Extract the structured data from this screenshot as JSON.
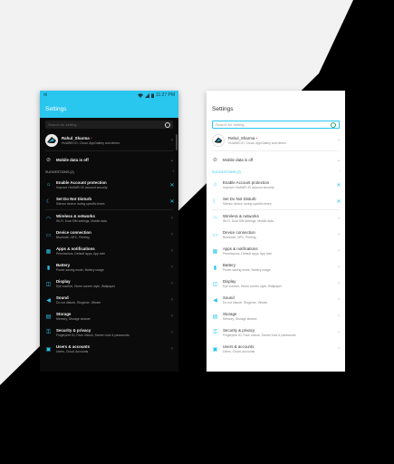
{
  "colors": {
    "accent": "#29c6ee",
    "dark_bg": "#0b0b0b",
    "light_bg": "#ffffff",
    "backdrop_dark": "#000000",
    "backdrop_light": "#f2f2f2"
  },
  "dark": {
    "status": {
      "left": "✉",
      "time": "11:27 PM"
    },
    "title": "Settings",
    "search_placeholder": "Search for setting...",
    "account": {
      "name": "Rahul_Sharma",
      "sub": "HUAWEI ID, Cloud, AppGallery and others"
    },
    "mobile_data": "Mobile data is off",
    "suggestions_label": "SUGGESTIONS (2)",
    "suggestions": [
      {
        "title": "Enable Account protection",
        "sub": "Improve HUAWEI ID account security",
        "icon": "home-icon"
      },
      {
        "title": "Set Do Not Disturb",
        "sub": "Silence device during specific times",
        "icon": "moon-icon"
      }
    ],
    "items": [
      {
        "title": "Wireless & networks",
        "sub": "Wi-Fi, Dual SIM settings, Mobile data",
        "icon": "wifi-icon"
      },
      {
        "title": "Device connection",
        "sub": "Bluetooth, NFC, Printing",
        "icon": "device-icon"
      },
      {
        "title": "Apps & notifications",
        "sub": "Permissions, Default apps, App twin",
        "icon": "apps-icon"
      },
      {
        "title": "Battery",
        "sub": "Power saving mode, Battery usage",
        "icon": "battery-icon"
      },
      {
        "title": "Display",
        "sub": "Eye comfort, Home screen style, Wallpaper",
        "icon": "display-icon"
      },
      {
        "title": "Sound",
        "sub": "Do not disturb, Ringtone, Vibrate",
        "icon": "sound-icon"
      },
      {
        "title": "Storage",
        "sub": "Memory, Storage cleaner",
        "icon": "storage-icon"
      },
      {
        "title": "Security & privacy",
        "sub": "Fingerprint ID, Face unlock, Screen lock & passwords",
        "icon": "lock-icon"
      },
      {
        "title": "Users & accounts",
        "sub": "Users, Cloud, Accounts",
        "icon": "user-icon"
      }
    ]
  },
  "light": {
    "title": "Settings",
    "search_placeholder": "Search for setting...",
    "account": {
      "name": "Rahul_Sharma",
      "sub": "HUAWEI ID, Cloud, AppGallery and others"
    },
    "mobile_data": "Mobile data is off",
    "suggestions_label": "SUGGESTIONS (2)",
    "suggestions": [
      {
        "title": "Enable Account protection",
        "sub": "Improve HUAWEI ID account security",
        "icon": "home-icon"
      },
      {
        "title": "Set Do Not Disturb",
        "sub": "Silence device during specific times",
        "icon": "moon-icon"
      }
    ],
    "items": [
      {
        "title": "Wireless & networks",
        "sub": "Wi-Fi, Dual SIM settings, Mobile data",
        "icon": "wifi-icon"
      },
      {
        "title": "Device connection",
        "sub": "Bluetooth, NFC, Printing",
        "icon": "device-icon"
      },
      {
        "title": "Apps & notifications",
        "sub": "Permissions, Default apps, App twin",
        "icon": "apps-icon"
      },
      {
        "title": "Battery",
        "sub": "Power saving mode, Battery usage",
        "icon": "battery-icon"
      },
      {
        "title": "Display",
        "sub": "Eye comfort, Home screen style, Wallpaper",
        "icon": "display-icon"
      },
      {
        "title": "Sound",
        "sub": "Do not disturb, Ringtone, Vibrate",
        "icon": "sound-icon"
      },
      {
        "title": "Storage",
        "sub": "Memory, Storage cleaner",
        "icon": "storage-icon"
      },
      {
        "title": "Security & privacy",
        "sub": "Fingerprint ID, Face unlock, Screen lock & passwords",
        "icon": "lock-icon"
      },
      {
        "title": "Users & accounts",
        "sub": "Users, Cloud, Accounts",
        "icon": "user-icon"
      }
    ]
  }
}
